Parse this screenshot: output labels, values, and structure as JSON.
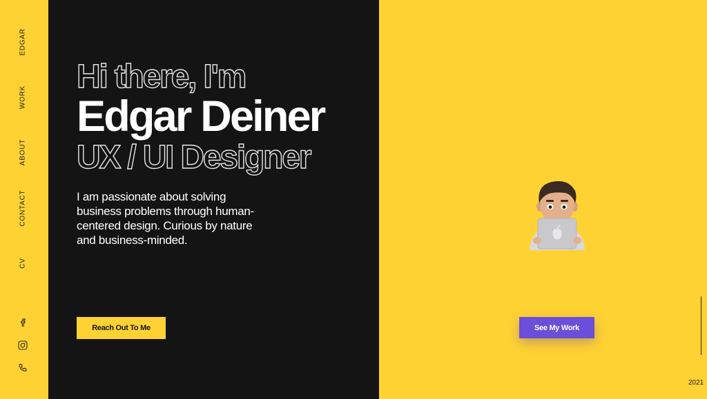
{
  "nav": {
    "items": [
      {
        "label": "EDGAR"
      },
      {
        "label": "WORK"
      },
      {
        "label": "ABOUT"
      },
      {
        "label": "CONTACT"
      },
      {
        "label": "CV"
      }
    ],
    "social": [
      "facebook-icon",
      "instagram-icon",
      "phone-icon"
    ]
  },
  "hero": {
    "greeting": "Hi there, I'm",
    "name": "Edgar Deiner",
    "role": "UX / UI Designer",
    "intro": "I am passionate about solving business problems through human-centered design. Curious by nature and business-minded.",
    "cta_label": "Reach Out To Me"
  },
  "showcase": {
    "avatar_icon": "memoji-laptop-avatar",
    "cta_label": "See My Work",
    "year": "2021"
  },
  "colors": {
    "accent_yellow": "#FFD233",
    "dark_panel": "#141414",
    "purple_button": "#6B4FD8"
  }
}
